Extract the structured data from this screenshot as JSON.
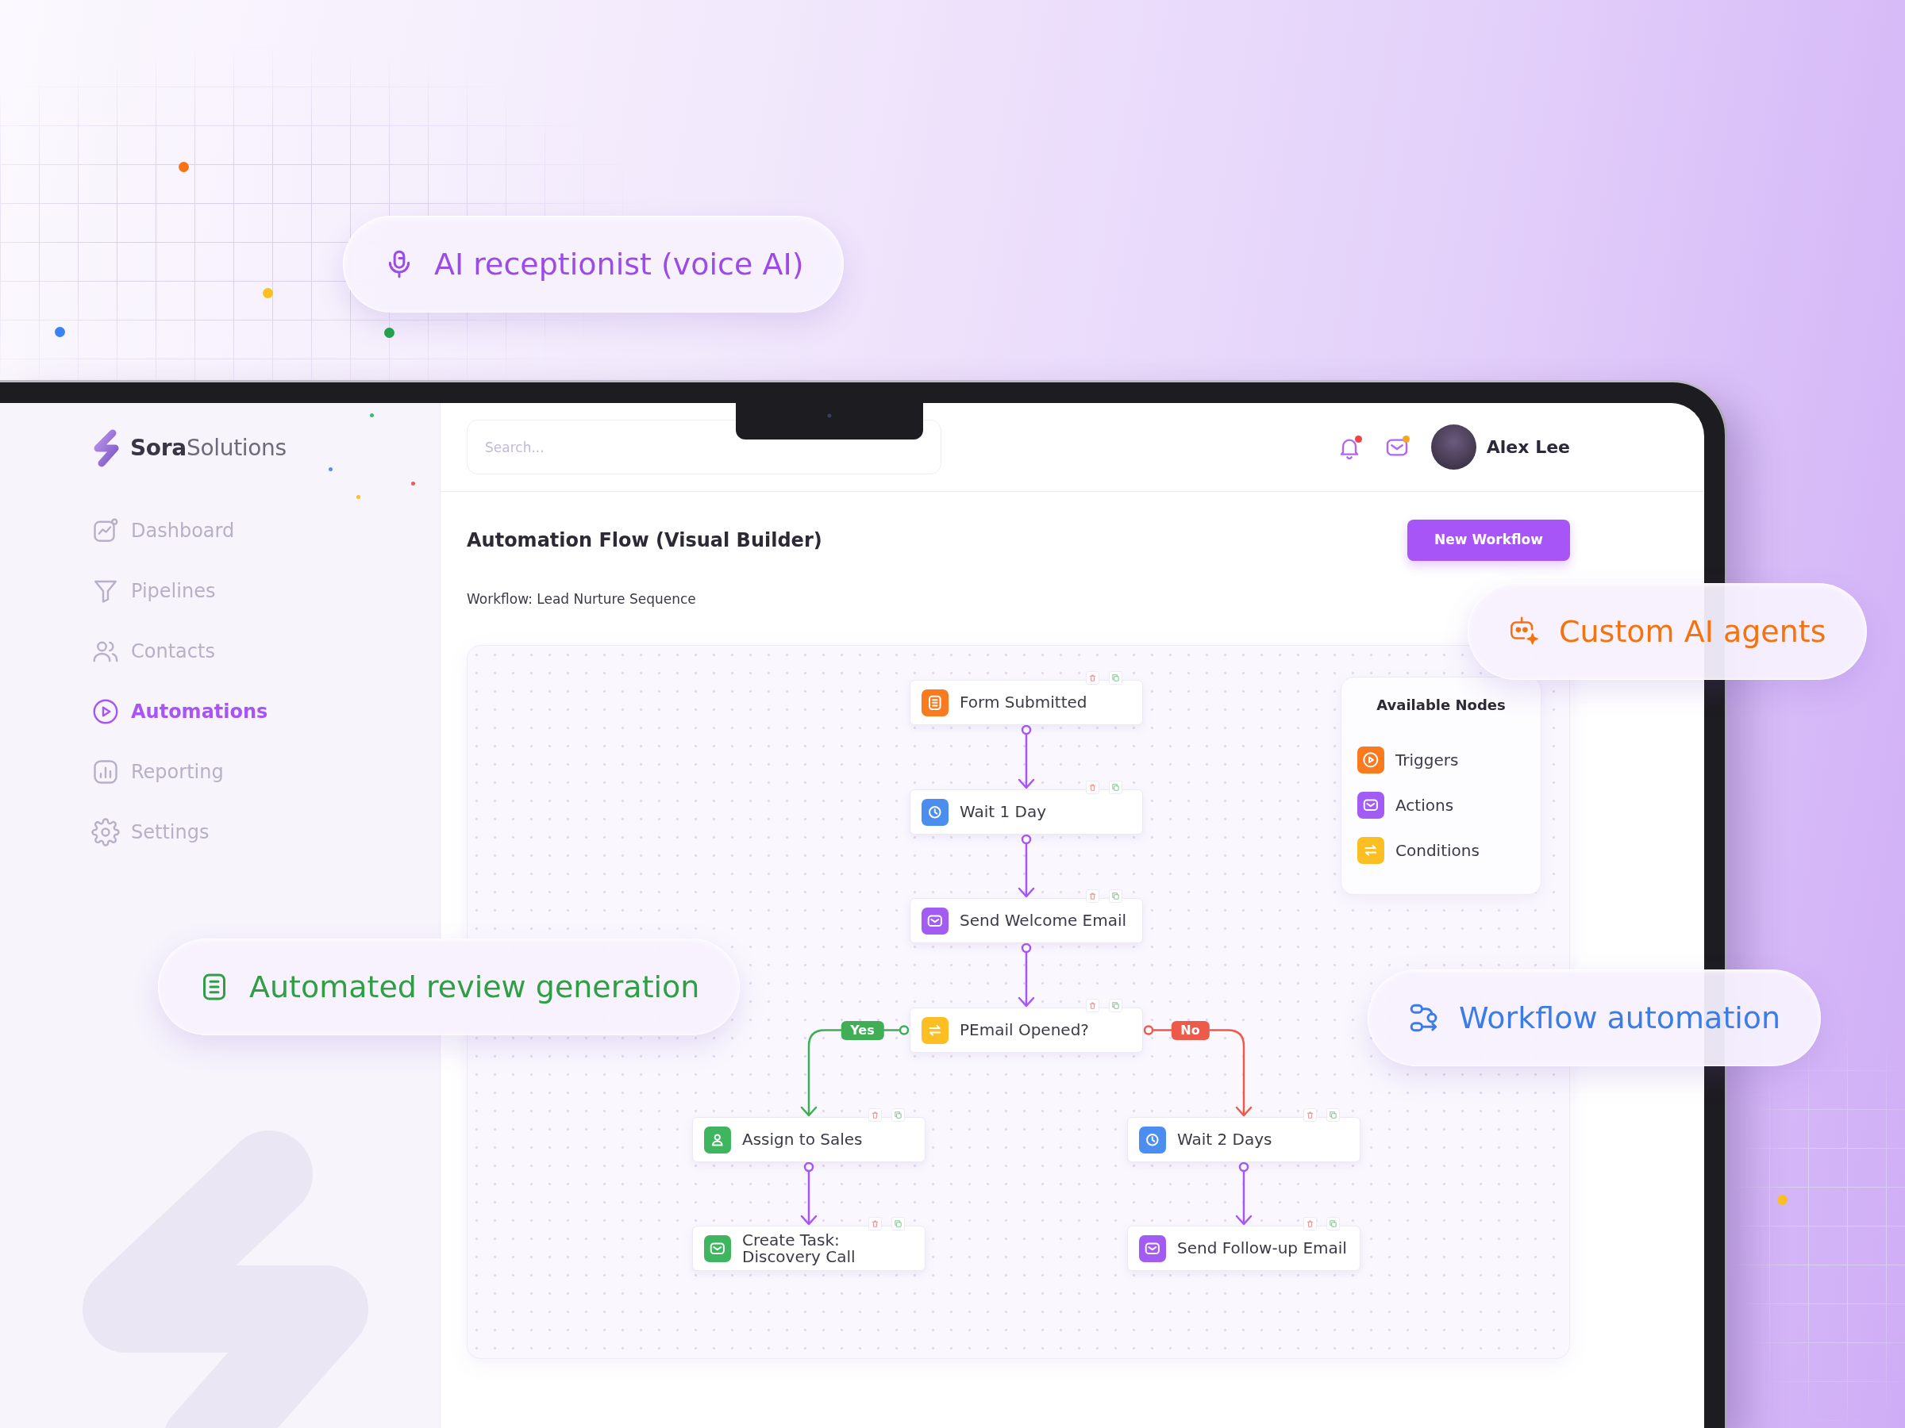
{
  "feature_badges": [
    {
      "label": "AI receptionist (voice AI)",
      "kind": "voice",
      "color": "#9b4be8"
    },
    {
      "label": "Custom AI agents",
      "kind": "agent",
      "color": "#f5730f"
    },
    {
      "label": "Automated review generation",
      "kind": "review",
      "color": "#2f9e44"
    },
    {
      "label": "Workflow automation",
      "kind": "workflow",
      "color": "#3b7de8"
    }
  ],
  "sidebar": {
    "brand": "**Sora**Solutions",
    "items": [
      {
        "label": "Dashboard",
        "selected": false
      },
      {
        "label": "Pipelines",
        "selected": false
      },
      {
        "label": "Contacts",
        "selected": false
      },
      {
        "label": "Automations",
        "selected": true
      },
      {
        "label": "Reporting",
        "selected": false
      },
      {
        "label": "Settings",
        "selected": false
      }
    ]
  },
  "header": {
    "search": {
      "placeholder": "Search..."
    },
    "notifications": {
      "unread": true
    },
    "messages": {
      "unread": true
    },
    "user": {
      "name": "Alex Lee"
    }
  },
  "page": {
    "title": "Automation Flow (Visual Builder)",
    "new_button": "New Workflow",
    "subtitle": "Workflow: Lead Nurture Sequence"
  },
  "flow": {
    "nodes": [
      {
        "label": "Form Submitted",
        "kind": "form",
        "color": "#f97a1f"
      },
      {
        "label": "Wait 1 Day",
        "kind": "delay",
        "color": "#4b8ef0"
      },
      {
        "label": "Send Welcome Email",
        "kind": "email",
        "color": "#a25bf3"
      },
      {
        "label": "PEmail Opened?",
        "kind": "condition",
        "color": "#fbbf24"
      }
    ],
    "branches": [
      {
        "label": "Yes",
        "color": "#3fae55",
        "nodes": [
          {
            "label": "Assign to Sales",
            "kind": "person",
            "color": "#3fb560"
          },
          {
            "label": "Create Task:\nDiscovery Call",
            "kind": "email",
            "color": "#3fb560"
          }
        ]
      },
      {
        "label": "No",
        "color": "#ee5a4a",
        "nodes": [
          {
            "label": "Wait 2 Days",
            "kind": "delay",
            "color": "#4b8ef0"
          },
          {
            "label": "Send Follow-up Email",
            "kind": "email",
            "color": "#a25bf3"
          }
        ]
      }
    ]
  },
  "palette": {
    "title": "Available Nodes",
    "items": [
      {
        "label": "Triggers",
        "kind": "trigger",
        "color": "#f97a1f"
      },
      {
        "label": "Actions",
        "kind": "action",
        "color": "#a25bf3"
      },
      {
        "label": "Conditions",
        "kind": "condition",
        "color": "#fbbf24"
      }
    ]
  }
}
